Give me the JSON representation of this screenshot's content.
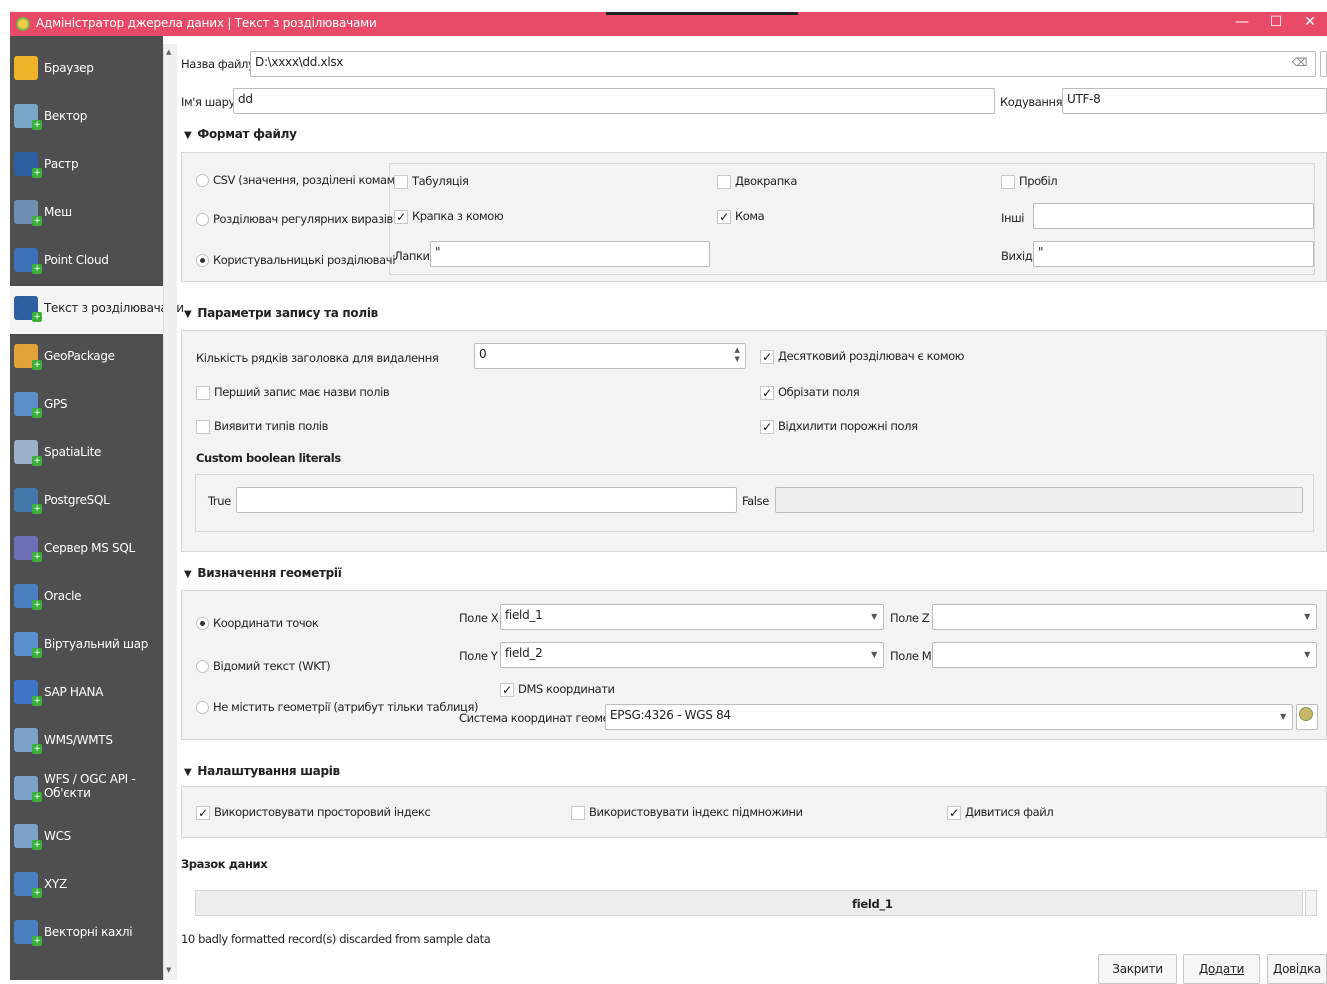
{
  "window": {
    "title": "Адміністратор джерела даних | Текст з розділювачами",
    "min": "—",
    "max": "☐",
    "close": "✕"
  },
  "sidebar": {
    "items": [
      {
        "label": "Браузер",
        "icon": "folder-icon",
        "color": "#f0b429"
      },
      {
        "label": "Вектор",
        "icon": "vector-icon",
        "color": "#7aa7c7"
      },
      {
        "label": "Растр",
        "icon": "raster-icon",
        "color": "#2e5fa3"
      },
      {
        "label": "Меш",
        "icon": "mesh-icon",
        "color": "#6f8fb0"
      },
      {
        "label": "Point Cloud",
        "icon": "point-cloud-icon",
        "color": "#3b6fb6"
      },
      {
        "label": "Текст з розділювачами",
        "icon": "delimited-text-icon",
        "color": "#2e5fa3"
      },
      {
        "label": "GeoPackage",
        "icon": "geopackage-icon",
        "color": "#e2a33b"
      },
      {
        "label": "GPS",
        "icon": "gps-icon",
        "color": "#5b8ec9"
      },
      {
        "label": "SpatiaLite",
        "icon": "spatialite-icon",
        "color": "#9ab1c9"
      },
      {
        "label": "PostgreSQL",
        "icon": "postgresql-icon",
        "color": "#4477aa"
      },
      {
        "label": "Сервер MS SQL",
        "icon": "mssql-icon",
        "color": "#6b6fb5"
      },
      {
        "label": "Oracle",
        "icon": "oracle-icon",
        "color": "#4a7fc1"
      },
      {
        "label": "Віртуальний шар",
        "icon": "virtual-layer-icon",
        "color": "#5a8fd0"
      },
      {
        "label": "SAP HANA",
        "icon": "sap-hana-icon",
        "color": "#3c75c4"
      },
      {
        "label": "WMS/WMTS",
        "icon": "wms-icon",
        "color": "#7ba3c8"
      },
      {
        "label": "WFS / OGC API -\nОб'єкти",
        "icon": "wfs-icon",
        "color": "#7ba3c8"
      },
      {
        "label": "WCS",
        "icon": "wcs-icon",
        "color": "#7ba3c8"
      },
      {
        "label": "XYZ",
        "icon": "xyz-icon",
        "color": "#4a7fc1"
      },
      {
        "label": "Векторні кахлі",
        "icon": "vector-tiles-icon",
        "color": "#4a7fc1"
      }
    ]
  },
  "file": {
    "filename_label": "Назва файлу",
    "filename_value": "D:\\xxxx\\dd.xlsx",
    "layer_label": "Ім'я шару",
    "layer_value": "dd",
    "encoding_label": "Кодування",
    "encoding_value": "UTF-8"
  },
  "format": {
    "header": "Формат файлу",
    "csv": "CSV (значення, розділені комами)",
    "regex": "Розділювач регулярних виразів",
    "custom": "Користувальницькі розділювачі",
    "tab": "Табуляція",
    "colon": "Двокрапка",
    "space": "Пробіл",
    "semicolon": "Крапка з комою",
    "comma": "Кома",
    "other_label": "Інші",
    "quote_label": "Лапки",
    "quote_value": "\"",
    "escape_label": "Вихід",
    "escape_value": "\""
  },
  "records": {
    "header": "Параметри запису та полів",
    "skip_label": "Кількість рядків заголовка для видалення",
    "skip_value": "0",
    "first_record": "Перший запис має назви полів",
    "detect_types": "Виявити типів полів",
    "decimal_comma": "Десятковий розділювач є комою",
    "trim": "Обрізати поля",
    "discard_empty": "Відхилити порожні поля",
    "bool_header": "Custom boolean literals",
    "true_label": "True",
    "false_label": "False"
  },
  "geometry": {
    "header": "Визначення геометрії",
    "point": "Координати точок",
    "wkt": "Відомий текст (WKT)",
    "none": "Не містить геометрії (атрибут тільки таблиця)",
    "x_label": "Поле X",
    "x_value": "field_1",
    "y_label": "Поле Y",
    "y_value": "field_2",
    "z_label": "Поле Z",
    "m_label": "Поле M",
    "dms": "DMS координати",
    "crs_label": "Система координат геометрії",
    "crs_value": "EPSG:4326 - WGS 84"
  },
  "layer_settings": {
    "header": "Налаштування шарів",
    "spatial_index": "Використовувати просторовий індекс",
    "subset_index": "Використовувати індекс підмножини",
    "watch_file": "Дивитися файл"
  },
  "sample": {
    "header": "Зразок даних",
    "column": "field_1",
    "note": "10 badly formatted record(s) discarded from sample data"
  },
  "buttons": {
    "close": "Закрити",
    "add": "Додати",
    "help": "Довідка"
  }
}
